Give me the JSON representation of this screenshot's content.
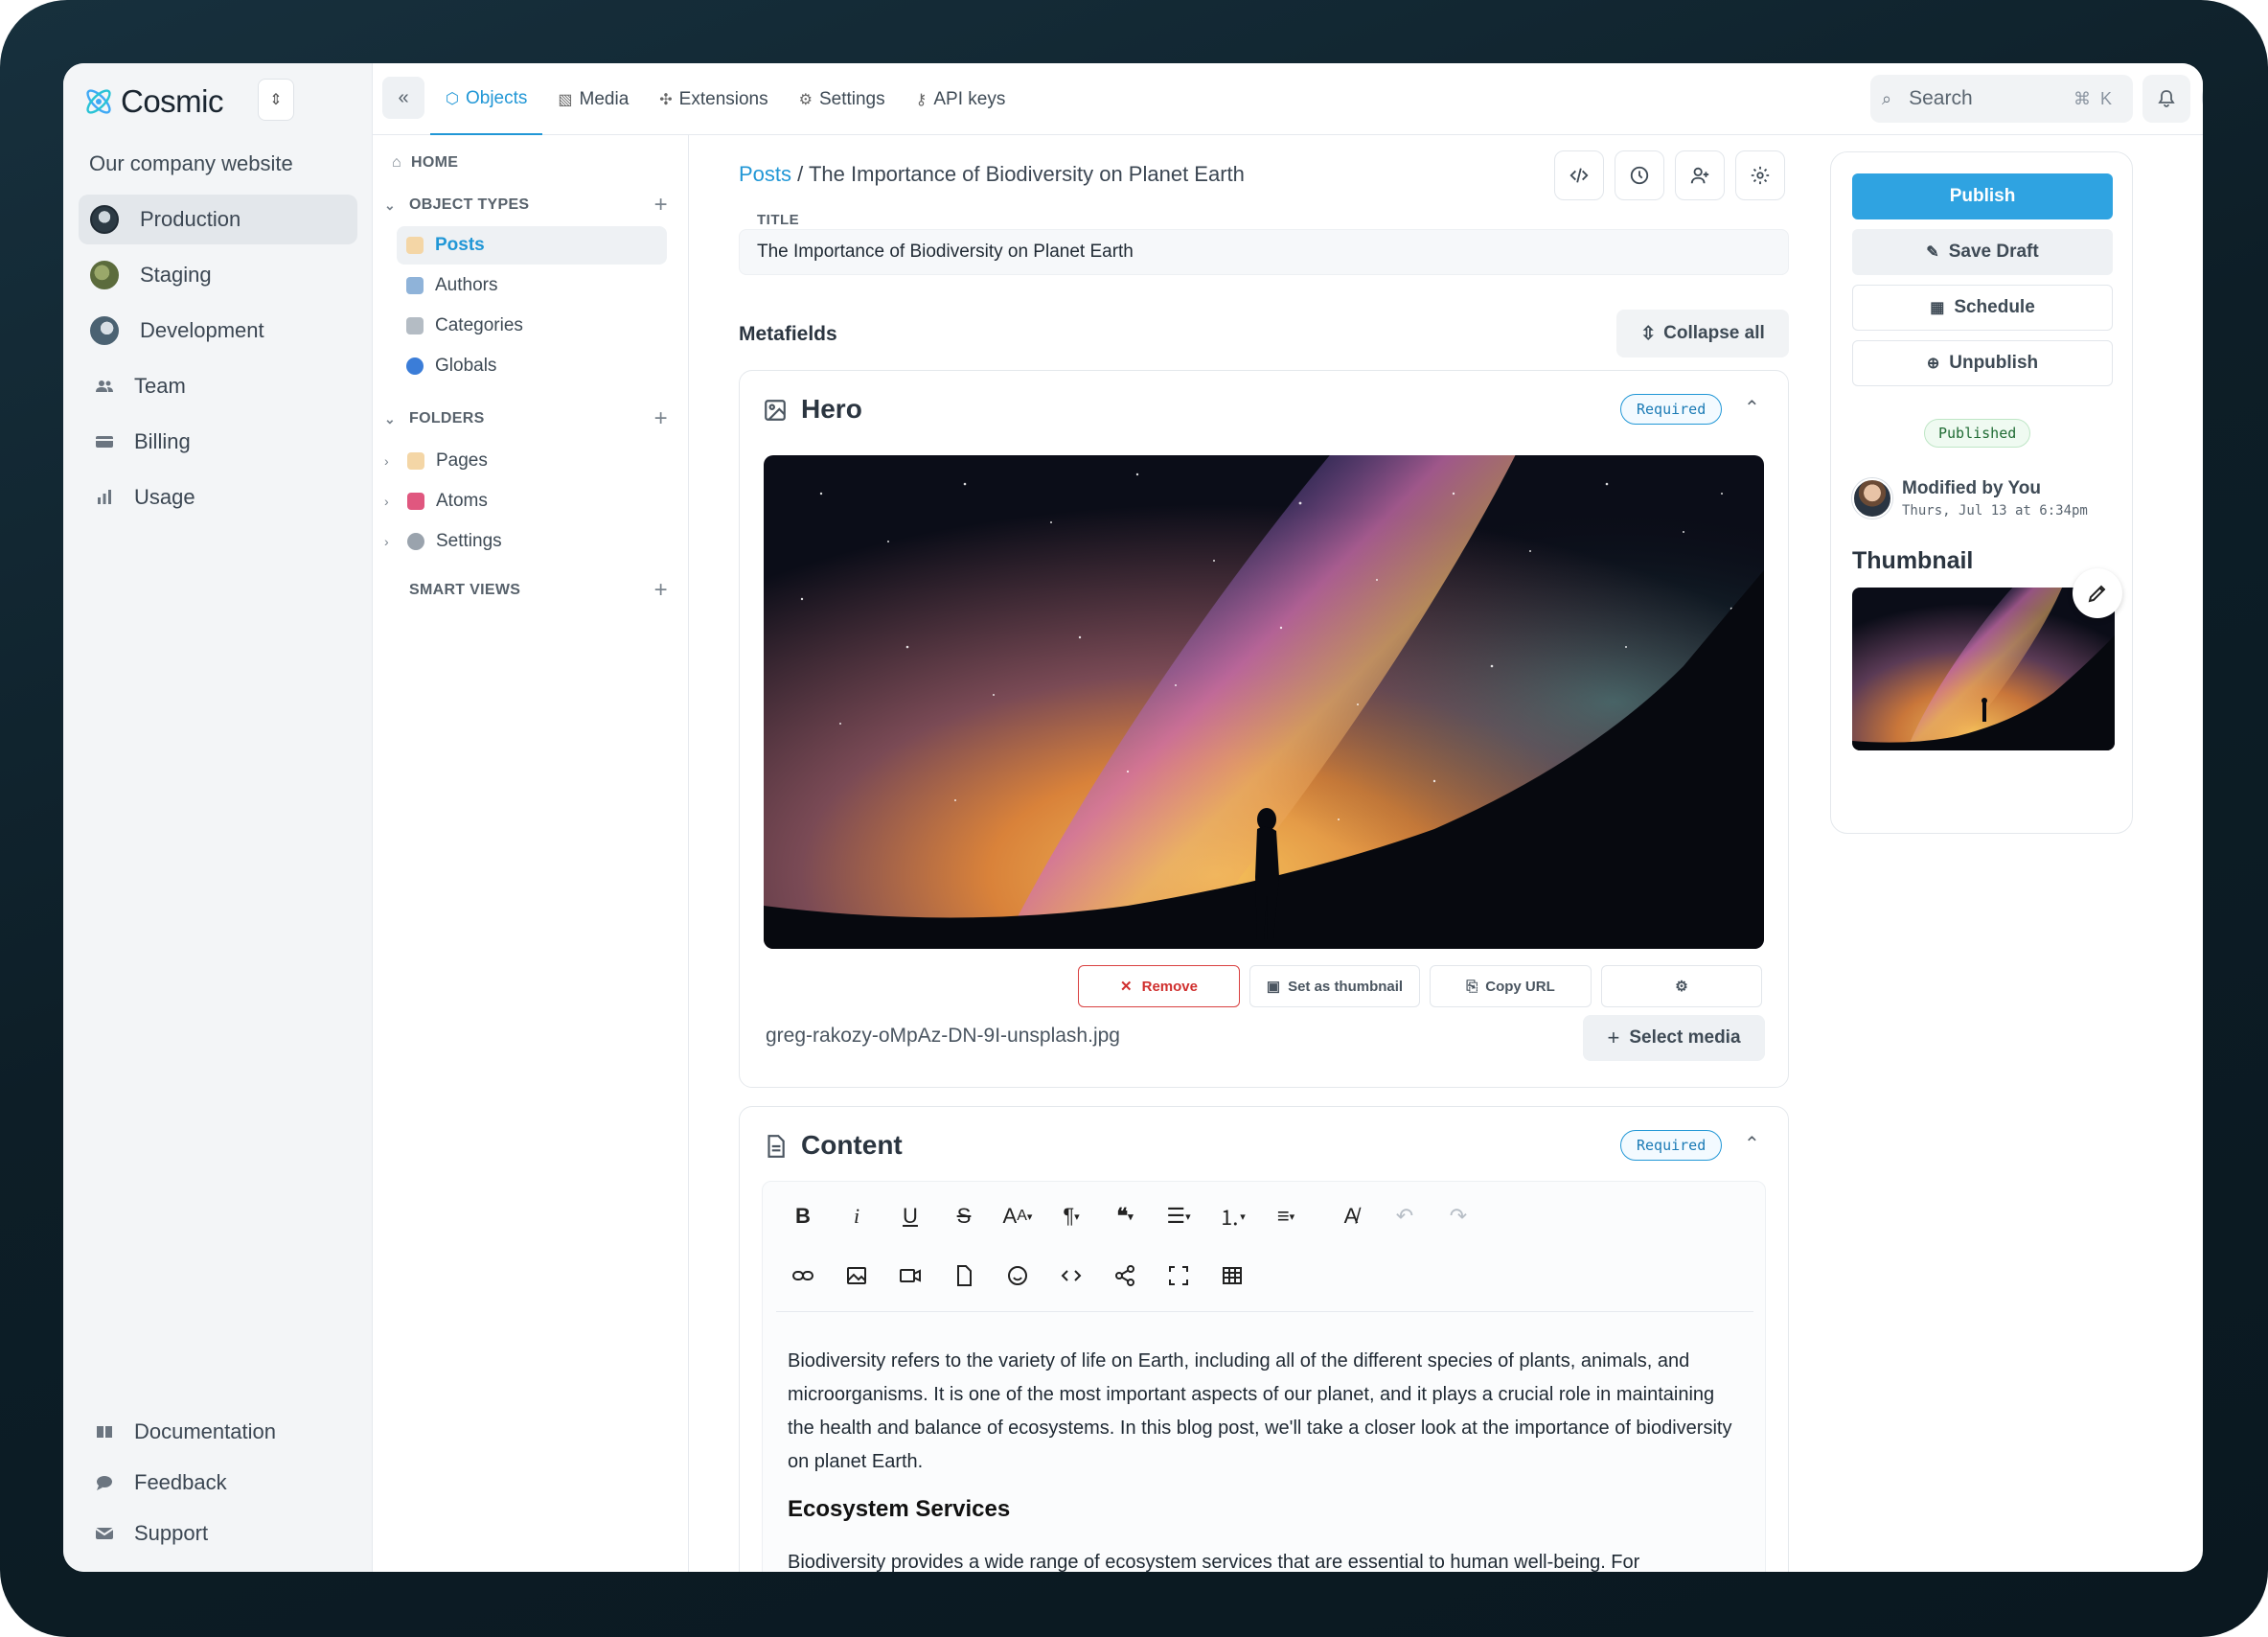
{
  "app": {
    "logo_text": "Cosmic",
    "site_name": "Our company website"
  },
  "sidebar": {
    "environments": [
      {
        "label": "Production",
        "color": "#2c3a44"
      },
      {
        "label": "Staging",
        "color": "#5b6b3c"
      },
      {
        "label": "Development",
        "color": "#4b6272"
      }
    ],
    "items": [
      {
        "label": "Team",
        "icon": "team-icon"
      },
      {
        "label": "Billing",
        "icon": "billing-icon"
      },
      {
        "label": "Usage",
        "icon": "usage-icon"
      }
    ],
    "bottom": [
      {
        "label": "Documentation",
        "icon": "documentation-icon"
      },
      {
        "label": "Feedback",
        "icon": "feedback-icon"
      },
      {
        "label": "Support",
        "icon": "support-icon"
      }
    ]
  },
  "topbar": {
    "tabs": [
      {
        "label": "Objects",
        "icon": "cube-icon",
        "glyph": "⬡",
        "active": true
      },
      {
        "label": "Media",
        "icon": "image-icon",
        "glyph": "▧",
        "active": false
      },
      {
        "label": "Extensions",
        "icon": "puzzle-icon",
        "glyph": "✣",
        "active": false
      },
      {
        "label": "Settings",
        "icon": "gear-icon",
        "glyph": "⚙",
        "active": false
      },
      {
        "label": "API keys",
        "icon": "key-icon",
        "glyph": "⚷",
        "active": false
      }
    ],
    "search_label": "Search",
    "search_shortcut": "⌘K"
  },
  "tree": {
    "home": "HOME",
    "object_types_heading": "OBJECT TYPES",
    "object_types": [
      {
        "label": "Posts",
        "emoji_color": "#f4d6a6",
        "selected": true
      },
      {
        "label": "Authors",
        "emoji_color": "#8fb3d9",
        "selected": false
      },
      {
        "label": "Categories",
        "emoji_color": "#b4bcc4",
        "selected": false
      },
      {
        "label": "Globals",
        "emoji_color": "#3b7dd8",
        "selected": false
      }
    ],
    "folders_heading": "FOLDERS",
    "folders": [
      {
        "label": "Pages",
        "emoji_color": "#f4d6a6"
      },
      {
        "label": "Atoms",
        "emoji_color": "#e0577f"
      },
      {
        "label": "Settings",
        "emoji_color": "#9aa3ad"
      }
    ],
    "smart_views_heading": "SMART VIEWS"
  },
  "editor": {
    "breadcrumb_link": "Posts",
    "breadcrumb_sep": " / ",
    "breadcrumb_current": "The Importance of Biodiversity on Planet Earth",
    "title_label": "TITLE",
    "title_value": "The Importance of Biodiversity on Planet Earth",
    "metafields_label": "Metafields",
    "collapse_all": "Collapse all",
    "hero": {
      "title": "Hero",
      "badge": "Required",
      "actions": {
        "remove": "Remove",
        "thumbnail": "Set as thumbnail",
        "copy": "Copy URL"
      },
      "file_name": "greg-rakozy-oMpAz-DN-9I-unsplash.jpg",
      "select_media": "Select media"
    },
    "content": {
      "title": "Content",
      "badge": "Required",
      "paragraph1": "Biodiversity refers to the variety of life on Earth, including all of the different species of plants, animals, and microorganisms. It is one of the most important aspects of our planet, and it plays a crucial role in maintaining the health and balance of ecosystems. In this blog post, we'll take a closer look at the importance of biodiversity on planet Earth.",
      "heading": "Ecosystem Services",
      "paragraph2": "Biodiversity provides a wide range of ecosystem services that are essential to human well-being. For"
    }
  },
  "publish": {
    "publish_label": "Publish",
    "draft_label": "Save Draft",
    "schedule_label": "Schedule",
    "unpublish_label": "Unpublish",
    "status": "Published",
    "modified_by": "Modified by You",
    "modified_time": "Thurs, Jul 13 at 6:34pm",
    "thumbnail_label": "Thumbnail"
  },
  "colors": {
    "accent": "#2197d6",
    "publish": "#2fa3e1",
    "danger": "#d0302f"
  }
}
